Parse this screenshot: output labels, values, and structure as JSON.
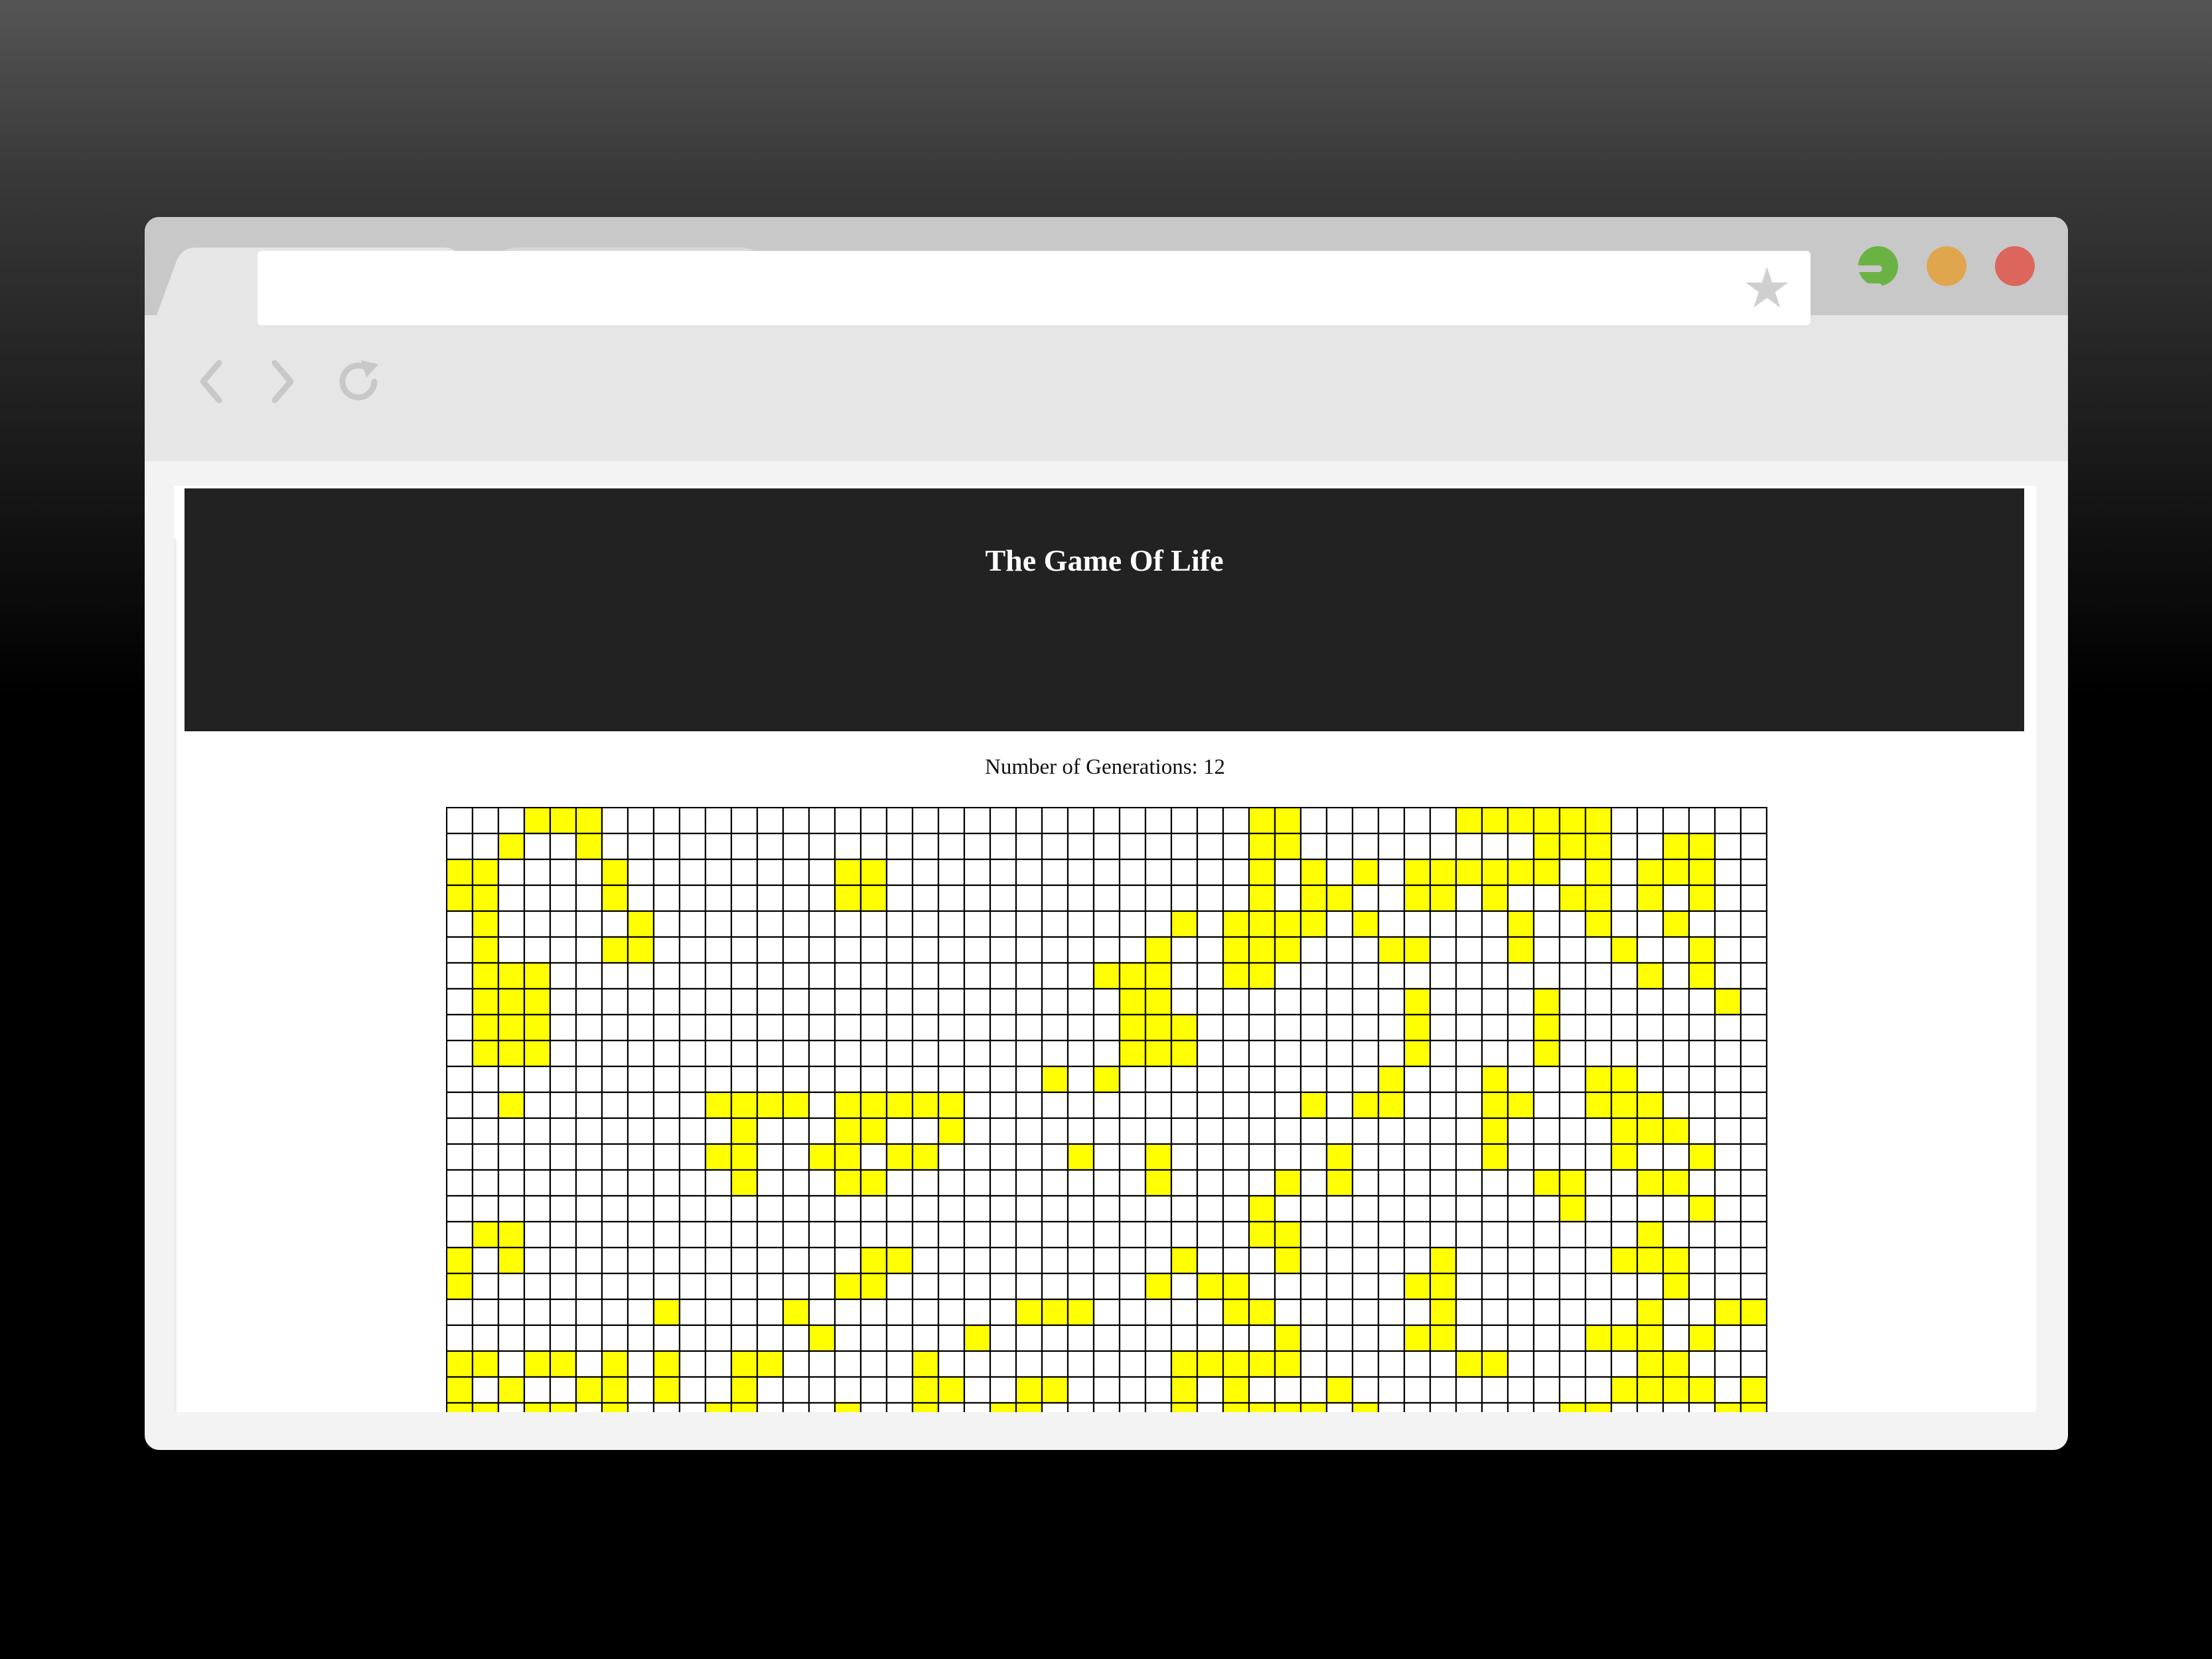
{
  "browser": {
    "tabs": [
      {
        "title": ""
      },
      {
        "title": ""
      }
    ],
    "address_bar": {
      "value": "",
      "placeholder": ""
    },
    "icons": [
      "back-icon",
      "forward-icon",
      "reload-icon",
      "bookmark-star-icon",
      "menu-icon"
    ],
    "traffic_lights": [
      "#6bb244",
      "#e0a64e",
      "#dc655c"
    ]
  },
  "page": {
    "title": "The Game Of Life",
    "generations_text": "Number of Generations: 12"
  },
  "board": {
    "cols": 51,
    "visible_rows": 24,
    "live_color": "#ffff00",
    "dead_color": "#ffffff",
    "grid_color": "#000000",
    "rows": [
      "...###.........................##......######......",
      "..#..#.........................##.........###..##..",
      "##....#........##..............#.#.#.######.#.###..",
      "##....#........##..............#.##..##.#..##.#.#..",
      ".#.....#....................#.####.#.....#..#..#...",
      ".#....##...................#..###...##...#...#..#..",
      ".###.....................###..##..............#.#..",
      ".###......................##.........#....#......#.",
      ".###......................###........#....#........",
      ".###......................###........#....#........",
      ".......................#.#..........#...#...##.....",
      "..#.......####.#####.............#.##...##..###....",
      "...........#...##..#....................#....###...",
      "..........##..##.##.....#..#......#.....#....#..#..",
      "...........#...##..........#....#.#.......##..##...",
      "...............................#...........#....#..",
      ".##............................##.............#.....",
      "#.#.............##..........#...#.....#......###...",
      "#..............##..........#.##......##........#...",
      "........#....#........###.....##......#.......#..##",
      "..............#.....#...........#....##.....###.#..",
      "##.##.#.#..##.....#.........#####......##.....##...",
      "#.#..##.#..#......##..##....#.#...#..........####.#",
      "##.##.#...##...#..#..##.....#.####.#.......##....##"
    ]
  }
}
